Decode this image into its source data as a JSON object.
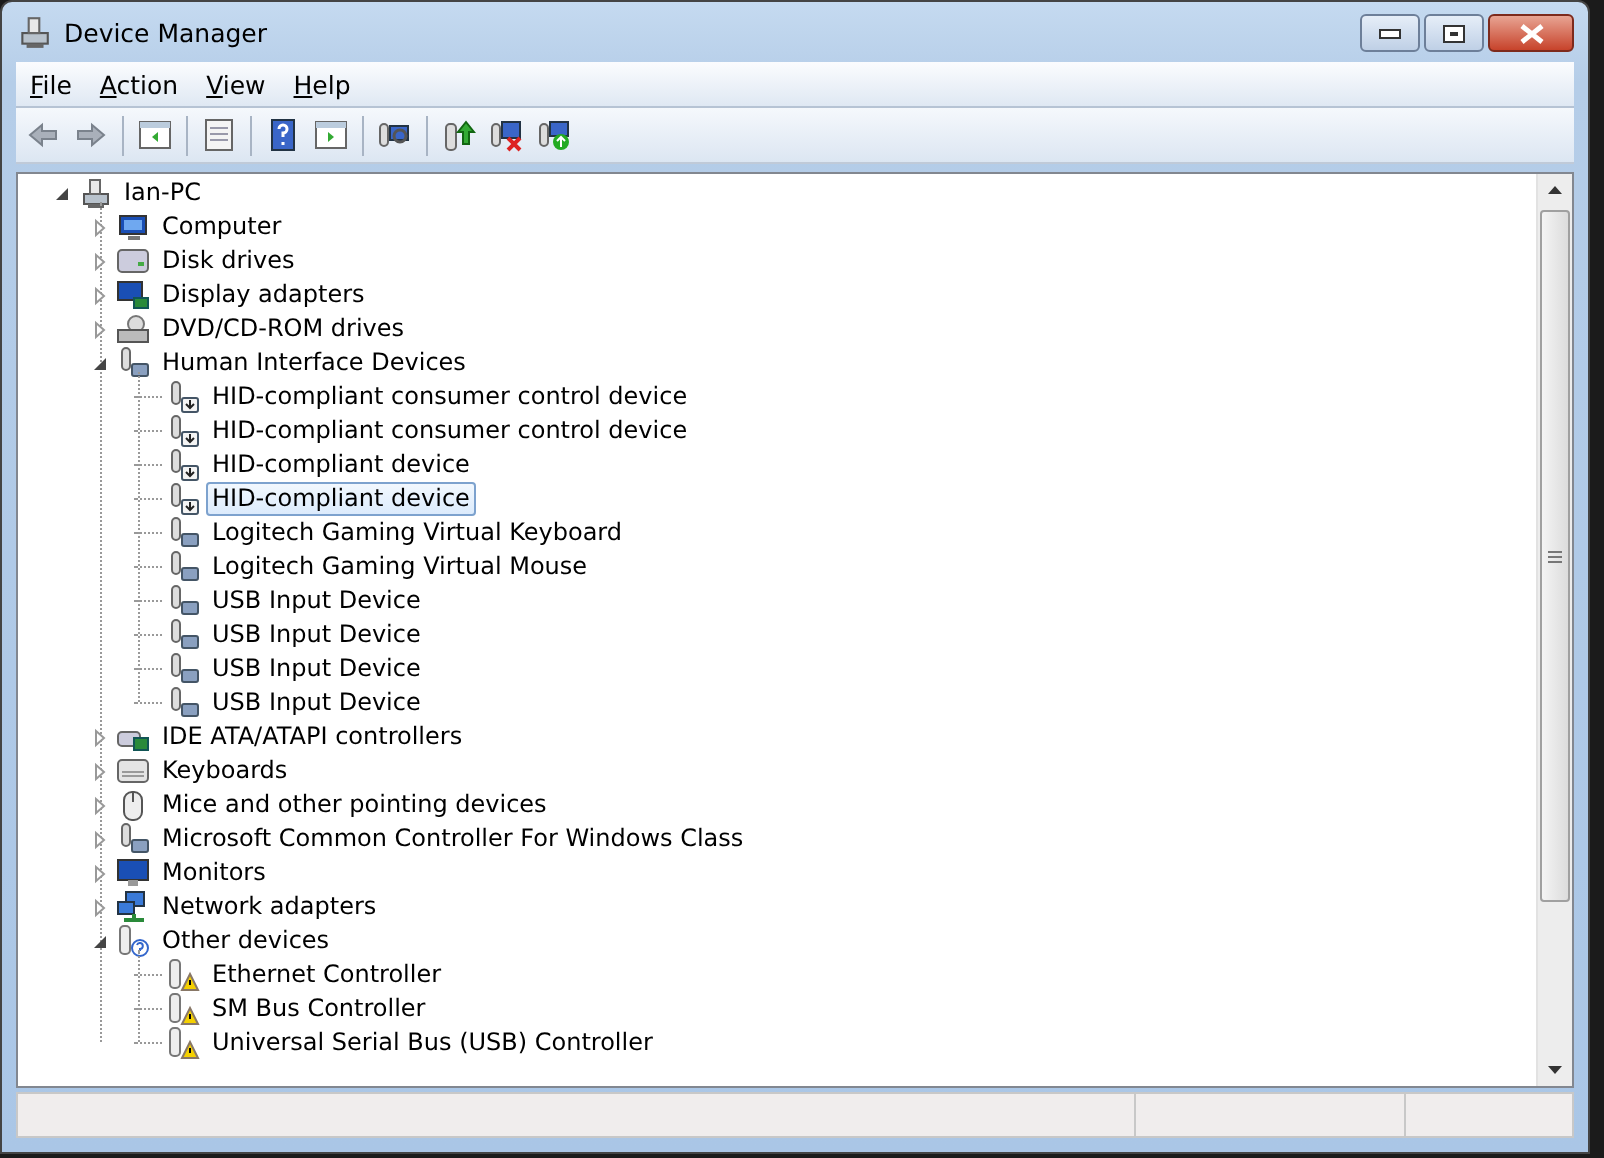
{
  "window": {
    "title": "Device Manager"
  },
  "menu": [
    "File",
    "Action",
    "View",
    "Help"
  ],
  "tree": [
    {
      "label": "Ian-PC",
      "kind": "pc",
      "expanded": true,
      "selected": false,
      "children": [
        {
          "label": "Computer",
          "kind": "computer",
          "expanded": false,
          "selected": false
        },
        {
          "label": "Disk drives",
          "kind": "disk",
          "expanded": false,
          "selected": false
        },
        {
          "label": "Display adapters",
          "kind": "display",
          "expanded": false,
          "selected": false
        },
        {
          "label": "DVD/CD-ROM drives",
          "kind": "dvd",
          "expanded": false,
          "selected": false
        },
        {
          "label": "Human Interface Devices",
          "kind": "hid",
          "expanded": true,
          "selected": false,
          "children": [
            {
              "label": "HID-compliant consumer control device",
              "kind": "hiddev",
              "selected": false
            },
            {
              "label": "HID-compliant consumer control device",
              "kind": "hiddev",
              "selected": false
            },
            {
              "label": "HID-compliant device",
              "kind": "hiddev",
              "selected": false
            },
            {
              "label": "HID-compliant device",
              "kind": "hiddev",
              "selected": true
            },
            {
              "label": "Logitech Gaming Virtual Keyboard",
              "kind": "hid",
              "selected": false
            },
            {
              "label": "Logitech Gaming Virtual Mouse",
              "kind": "hid",
              "selected": false
            },
            {
              "label": "USB Input Device",
              "kind": "hid",
              "selected": false
            },
            {
              "label": "USB Input Device",
              "kind": "hid",
              "selected": false
            },
            {
              "label": "USB Input Device",
              "kind": "hid",
              "selected": false
            },
            {
              "label": "USB Input Device",
              "kind": "hid",
              "selected": false
            }
          ]
        },
        {
          "label": "IDE ATA/ATAPI controllers",
          "kind": "ide",
          "expanded": false,
          "selected": false
        },
        {
          "label": "Keyboards",
          "kind": "keyboard",
          "expanded": false,
          "selected": false
        },
        {
          "label": "Mice and other pointing devices",
          "kind": "mouse",
          "expanded": false,
          "selected": false
        },
        {
          "label": "Microsoft Common Controller For Windows Class",
          "kind": "hid",
          "expanded": false,
          "selected": false
        },
        {
          "label": "Monitors",
          "kind": "monitor",
          "expanded": false,
          "selected": false
        },
        {
          "label": "Network adapters",
          "kind": "network",
          "expanded": false,
          "selected": false
        },
        {
          "label": "Other devices",
          "kind": "unknown",
          "expanded": true,
          "selected": false,
          "children": [
            {
              "label": "Ethernet Controller",
              "kind": "warning",
              "selected": false
            },
            {
              "label": "SM Bus Controller",
              "kind": "warning",
              "selected": false
            },
            {
              "label": "Universal Serial Bus (USB) Controller",
              "kind": "warning",
              "selected": false
            }
          ]
        }
      ]
    }
  ]
}
